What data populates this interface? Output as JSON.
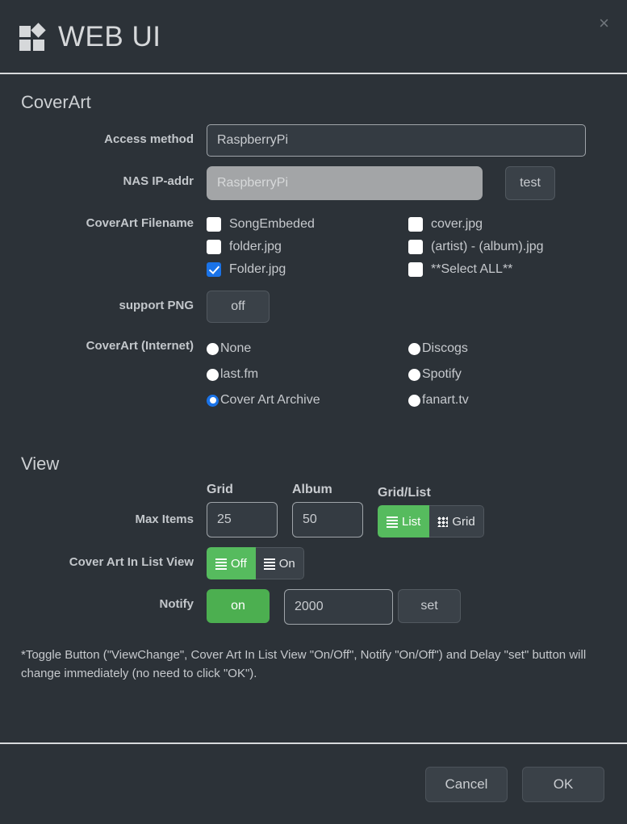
{
  "header": {
    "title": "WEB UI",
    "close_label": "×",
    "logo_icon": "grid-diamond-logo"
  },
  "coverart": {
    "section_title": "CoverArt",
    "access_method": {
      "label": "Access method",
      "value": "RaspberryPi"
    },
    "nas_ip": {
      "label": "NAS IP-addr",
      "value": "",
      "placeholder": "RaspberryPi",
      "test_button": "test"
    },
    "filename": {
      "label": "CoverArt Filename",
      "options": [
        {
          "label": "SongEmbeded",
          "checked": false
        },
        {
          "label": "cover.jpg",
          "checked": false
        },
        {
          "label": "folder.jpg",
          "checked": false
        },
        {
          "label": "(artist) - (album).jpg",
          "checked": false
        },
        {
          "label": "Folder.jpg",
          "checked": true
        },
        {
          "label": "**Select ALL**",
          "checked": false
        }
      ]
    },
    "support_png": {
      "label": "support PNG",
      "value": "off"
    },
    "internet": {
      "label": "CoverArt (Internet)",
      "options": [
        {
          "label": "None",
          "selected": false
        },
        {
          "label": "Discogs",
          "selected": false
        },
        {
          "label": "last.fm",
          "selected": false
        },
        {
          "label": "Spotify",
          "selected": false
        },
        {
          "label": "Cover Art Archive",
          "selected": true
        },
        {
          "label": "fanart.tv",
          "selected": false
        }
      ]
    }
  },
  "view": {
    "section_title": "View",
    "max_items": {
      "label": "Max Items",
      "grid_caption": "Grid",
      "grid_value": "25",
      "album_caption": "Album",
      "album_value": "50",
      "toggle_caption": "Grid/List",
      "toggle": {
        "option_a": "List",
        "option_b": "Grid",
        "active": "List"
      }
    },
    "cover_art_list_view": {
      "label": "Cover Art In List View",
      "option_a": "Off",
      "option_b": "On",
      "active": "Off"
    },
    "notify": {
      "label": "Notify",
      "state": "on",
      "delay_value": "2000",
      "set_button": "set"
    }
  },
  "footnote": "*Toggle Button (\"ViewChange\", Cover Art In List View \"On/Off\", Notify \"On/Off\") and Delay \"set\" button will change immediately (no need to click \"OK\").",
  "footer": {
    "cancel_label": "Cancel",
    "ok_label": "OK"
  },
  "colors": {
    "background": "#2c3238",
    "accent_green": "#4caf50",
    "accent_blue": "#1a73e8",
    "text": "#c6c9cd",
    "border": "#d8dadc"
  }
}
